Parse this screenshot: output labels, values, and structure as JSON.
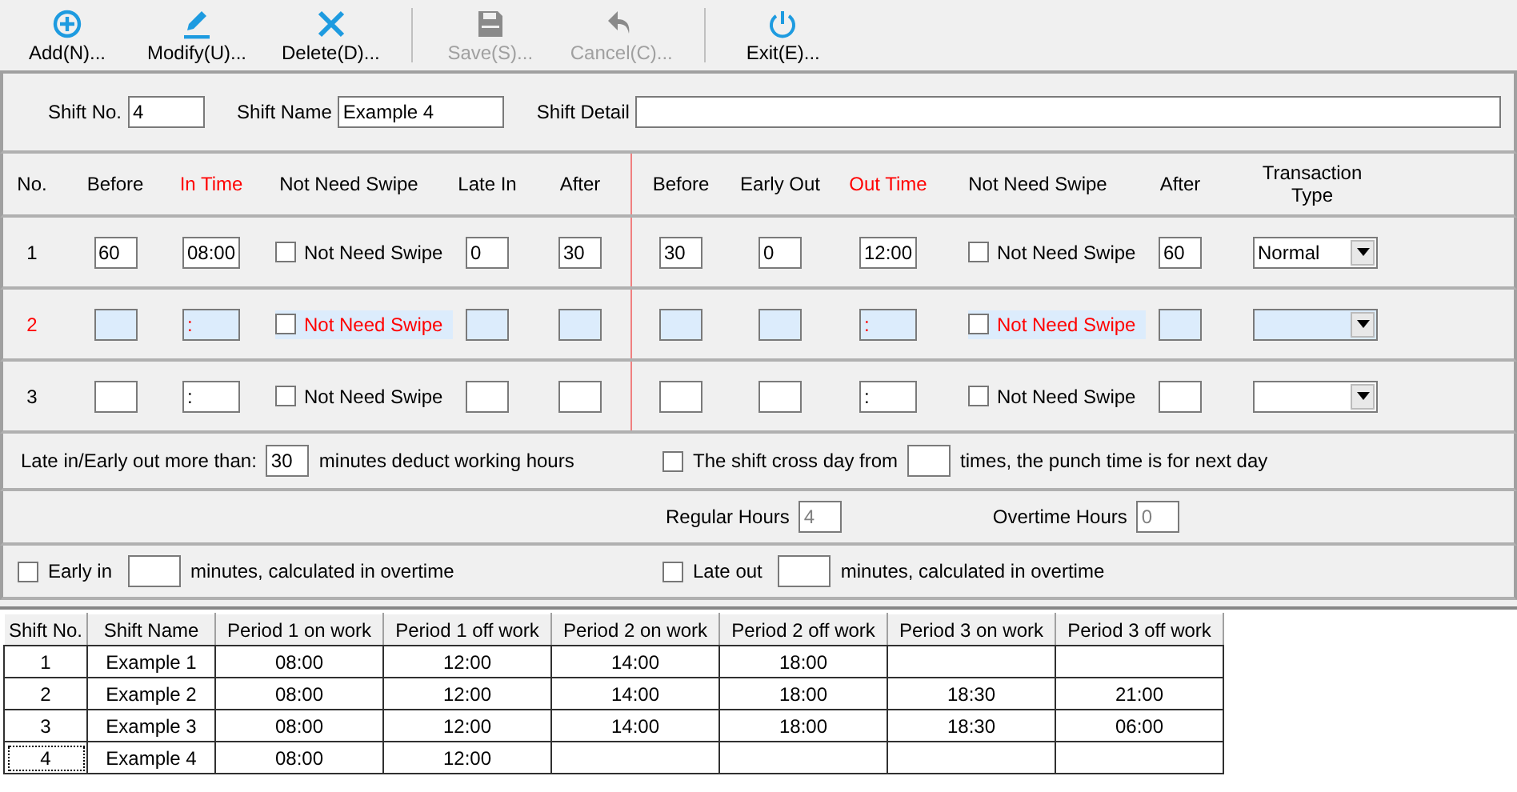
{
  "toolbar": {
    "groups": [
      {
        "buttons": [
          {
            "kind": "add",
            "label": "Add(N)...",
            "disabled": false
          },
          {
            "kind": "modify",
            "label": "Modify(U)...",
            "disabled": false
          },
          {
            "kind": "delete",
            "label": "Delete(D)...",
            "disabled": false
          }
        ]
      },
      {
        "buttons": [
          {
            "kind": "save",
            "label": "Save(S)...",
            "disabled": true
          },
          {
            "kind": "cancel",
            "label": "Cancel(C)...",
            "disabled": true
          }
        ]
      },
      {
        "buttons": [
          {
            "kind": "exit",
            "label": "Exit(E)...",
            "disabled": false
          }
        ]
      }
    ]
  },
  "shift_header": {
    "fields": [
      {
        "label": "Shift No.",
        "value": "4"
      },
      {
        "label": "Shift Name",
        "value": "Example 4"
      },
      {
        "label": "Shift Detail"
      }
    ]
  },
  "periods": {
    "columns": [
      {
        "label": "No.",
        "emphasis": false
      },
      {
        "label": "Before",
        "emphasis": false
      },
      {
        "label": "In Time",
        "emphasis": true
      },
      {
        "label": "Not Need Swipe",
        "emphasis": false
      },
      {
        "label": "Late In",
        "emphasis": false
      },
      {
        "label": "After",
        "emphasis": false
      },
      {
        "label": "Before",
        "emphasis": false
      },
      {
        "label": "Early Out",
        "emphasis": false
      },
      {
        "label": "Out Time",
        "emphasis": true
      },
      {
        "label": "Not Need Swipe",
        "emphasis": false
      },
      {
        "label": "After",
        "emphasis": false
      },
      {
        "label": "Transaction Type",
        "emphasis": false
      }
    ],
    "rows": [
      {
        "no": "1",
        "selected": false,
        "before_in": "60",
        "in_time": "08:00",
        "in_no_swipe": {
          "label": "Not Need Swipe",
          "checked": false
        },
        "late_in": "0",
        "after_in": "30",
        "before_out": "30",
        "early_out": "0",
        "out_time": "12:00",
        "out_no_swipe": {
          "label": "Not Need Swipe",
          "checked": false
        },
        "after_out": "60",
        "transaction_type": "Normal"
      },
      {
        "no": "2",
        "selected": true,
        "in_time": ":",
        "in_no_swipe": {
          "label": "Not Need Swipe",
          "checked": false
        },
        "out_time": ":",
        "out_no_swipe": {
          "label": "Not Need Swipe",
          "checked": false
        }
      },
      {
        "no": "3",
        "selected": false,
        "in_time": ":",
        "in_no_swipe": {
          "label": "Not Need Swipe",
          "checked": false
        },
        "out_time": ":",
        "out_no_swipe": {
          "label": "Not Need Swipe",
          "checked": false
        }
      }
    ]
  },
  "options": {
    "deduct": {
      "lead": "Late in/Early out more than:",
      "value": "30",
      "trail": "minutes deduct working hours"
    },
    "cross_day": {
      "checked": false,
      "lead": "The shift cross day from",
      "trail": "times, the punch time is for next day"
    },
    "regular_hours": {
      "label": "Regular Hours",
      "value": "4",
      "disabled": true
    },
    "overtime_hours": {
      "label": "Overtime Hours",
      "value": "0",
      "disabled": true
    },
    "early_in": {
      "checked": false,
      "lead": "Early in",
      "trail": "minutes, calculated in overtime"
    },
    "late_out": {
      "checked": false,
      "lead": "Late out",
      "trail": "minutes, calculated in overtime"
    }
  },
  "shift_table": {
    "columns": [
      "Shift No.",
      "Shift Name",
      "Period 1 on work",
      "Period 1 off work",
      "Period 2 on work",
      "Period 2 off work",
      "Period 3 on work",
      "Period 3 off work"
    ],
    "rows": [
      {
        "focused": false,
        "cells": [
          "1",
          "Example 1",
          "08:00",
          "12:00",
          "14:00",
          "18:00"
        ]
      },
      {
        "focused": false,
        "cells": [
          "2",
          "Example 2",
          "08:00",
          "12:00",
          "14:00",
          "18:00",
          "18:30",
          "21:00"
        ]
      },
      {
        "focused": false,
        "cells": [
          "3",
          "Example 3",
          "08:00",
          "12:00",
          "14:00",
          "18:00",
          "18:30",
          "06:00"
        ]
      },
      {
        "focused": true,
        "cells": [
          "4",
          "Example 4",
          "08:00",
          "12:00"
        ]
      }
    ]
  }
}
